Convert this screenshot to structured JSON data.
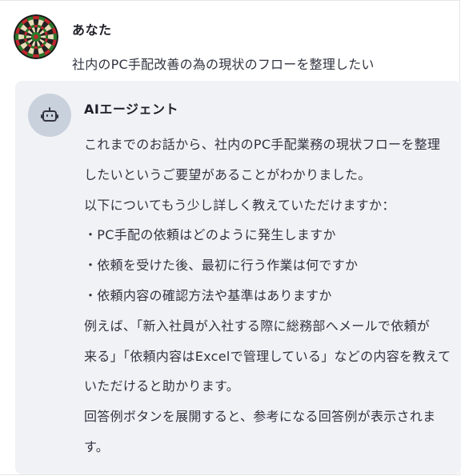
{
  "user_message": {
    "name": "あなた",
    "text": "社内のPC手配改善の為の現状のフローを整理したい"
  },
  "agent_message": {
    "name": "AIエージェント",
    "lines": [
      "これまでのお話から、社内のPC手配業務の現状フローを整理",
      "したいというご要望があることがわかりました。",
      "以下についてもう少し詳しく教えていただけますか：",
      "・PC手配の依頼はどのように発生しますか",
      "・依頼を受けた後、最初に行う作業は何ですか",
      "・依頼内容の確認方法や基準はありますか",
      "例えば、「新入社員が入社する際に総務部へメールで依頼が",
      "来る」「依頼内容はExcelで管理している」などの内容を教えて",
      "いただけると助かります。",
      "回答例ボタンを展開すると、参考になる回答例が表示されま",
      "す。"
    ]
  },
  "icons": {
    "user_avatar": "dartboard-avatar-icon",
    "agent_avatar": "robot-icon"
  },
  "colors": {
    "agent_card_bg": "#f0f2f6",
    "bot_avatar_bg": "#c9d1dc",
    "text": "#31333f"
  }
}
